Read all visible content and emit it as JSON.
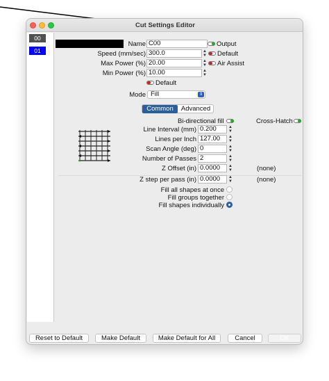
{
  "window": {
    "title": "Cut Settings Editor"
  },
  "sidebar": {
    "items": [
      {
        "label": "00",
        "bg": "#505050",
        "fg": "#ffffff"
      },
      {
        "label": "01",
        "bg": "#0000ff",
        "fg": "#ffffff"
      }
    ]
  },
  "form": {
    "color_swatch": "#000000",
    "name_label": "Name",
    "name_value": "C00",
    "output_label": "Output",
    "speed_label": "Speed (mm/sec)",
    "speed_value": "300.0",
    "default_label_1": "Default",
    "max_power_label": "Max Power (%)",
    "max_power_value": "20.00",
    "air_assist_label": "Air Assist",
    "min_power_label": "Min Power (%)",
    "min_power_value": "10.00",
    "default_label_2": "Default",
    "mode_label": "Mode",
    "mode_value": "Fill"
  },
  "tabs": [
    {
      "label": "Common",
      "active": true
    },
    {
      "label": "Advanced",
      "active": false
    }
  ],
  "fill": {
    "bidirectional_label": "Bi-directional fill",
    "crosshatch_label": "Cross-Hatch",
    "line_interval_label": "Line Interval (mm)",
    "line_interval_value": "0.200",
    "lines_per_inch_label": "Lines per Inch",
    "lines_per_inch_value": "127.00",
    "scan_angle_label": "Scan Angle (deg)",
    "scan_angle_value": "0",
    "passes_label": "Number of Passes",
    "passes_value": "2",
    "z_offset_label": "Z Offset (in)",
    "z_offset_value": "0.0000",
    "z_offset_note": "(none)",
    "z_step_label": "Z step per pass (in)",
    "z_step_value": "0.0000",
    "z_step_note": "(none)",
    "fill_all_label": "Fill all shapes at once",
    "fill_groups_label": "Fill groups together",
    "fill_individual_label": "Fill shapes individually"
  },
  "buttons": {
    "reset": "Reset to Default",
    "make_default": "Make Default",
    "make_default_all": "Make Default for All",
    "cancel": "Cancel",
    "ok": "OK"
  },
  "colors": {
    "accent": "#2a5e9c",
    "toggle_on": "#22aa22",
    "toggle_off": "#cc2222"
  }
}
